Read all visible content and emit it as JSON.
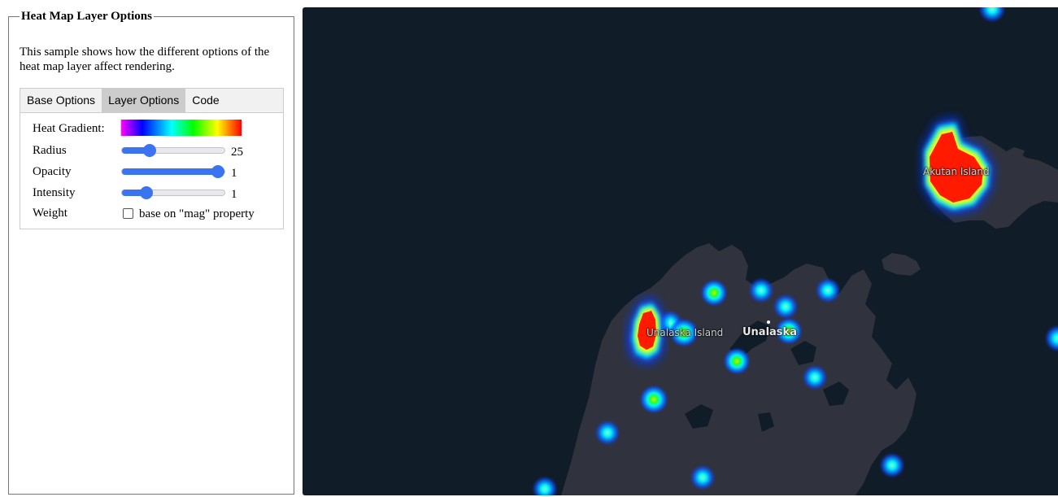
{
  "panel": {
    "title": "Heat Map Layer Options",
    "description": "This sample shows how the different options of the heat map layer affect rendering."
  },
  "tabs": [
    {
      "label": "Base Options",
      "active": false
    },
    {
      "label": "Layer Options",
      "active": true
    },
    {
      "label": "Code",
      "active": false
    }
  ],
  "options": {
    "heat_gradient_label": "Heat Gradient:",
    "radius": {
      "label": "Radius",
      "value": "25",
      "fraction": 0.27
    },
    "opacity": {
      "label": "Opacity",
      "value": "1",
      "fraction": 1.0
    },
    "intensity": {
      "label": "Intensity",
      "value": "1",
      "fraction": 0.24
    },
    "weight": {
      "label": "Weight",
      "checkbox_label": "base on \"mag\" property",
      "checked": false
    }
  },
  "map": {
    "labels": {
      "akutan": "Akutan Island",
      "unalaska_island": "Unalaska Island",
      "unalaska": "Unalaska"
    },
    "colors": {
      "water": "#101c27",
      "land": "#30333d",
      "accent": "#3b74f0"
    }
  }
}
